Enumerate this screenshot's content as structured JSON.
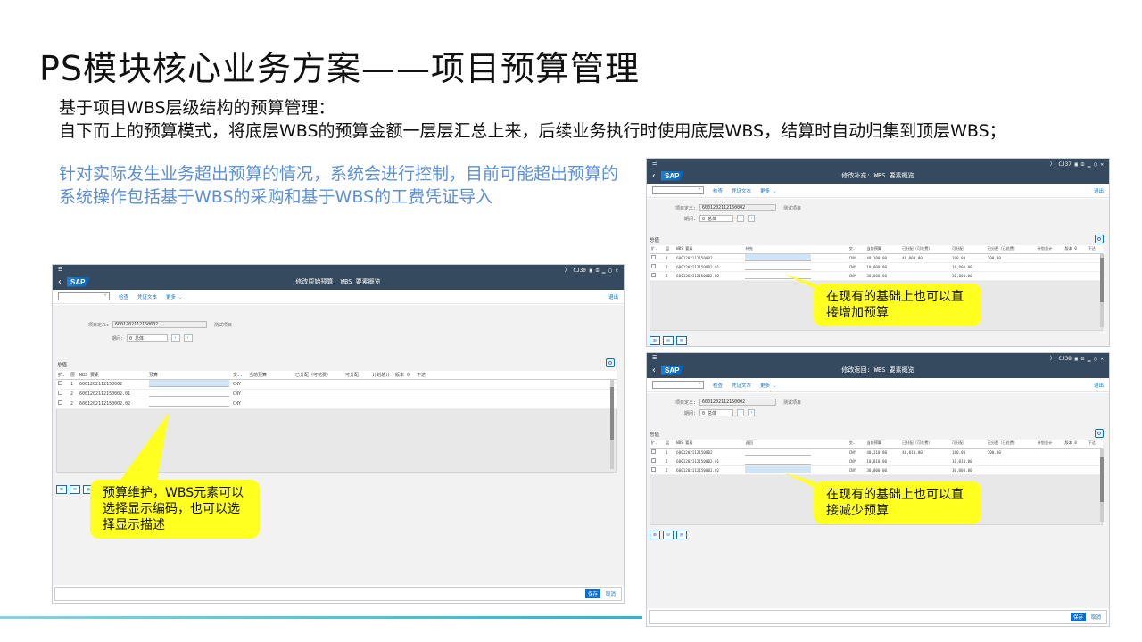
{
  "slide": {
    "title": "PS模块核心业务方案——项目预算管理",
    "intro_line1": "基于项目WBS层级结构的预算管理：",
    "intro_line2": "自下而上的预算模式，将底层WBS的预算金额一层层汇总上来，后续业务执行时使用底层WBS，结算时自动归集到顶层WBS；",
    "note": "针对实际发生业务超出预算的情况，系统会进行控制，目前可能超出预算的系统操作包括基于WBS的采购和基于WBS的工费凭证导入"
  },
  "callouts": {
    "left": "预算维护，WBS元素可以选择显示编码，也可以选择显示描述",
    "right_top": "在现有的基础上也可以直接增加预算",
    "right_bottom": "在现有的基础上也可以直接减少预算"
  },
  "window_main": {
    "tcode": "CJ30",
    "title": "修改原始预算: WBS 要素概览",
    "toolbar": [
      "检查",
      "凭证文本",
      "更多 ⌵"
    ],
    "exit": "退出",
    "project_label": "项目定义:",
    "project_value": "6001202112150002",
    "project_desc": "测试项目",
    "period_label": "期间:",
    "period_value": "0 总体",
    "section": "总值",
    "columns": [
      "扩.",
      "层",
      "WBS 要素",
      "预算",
      "交..",
      "当前预算",
      "已分配（可花费）",
      "可分配",
      "计划总计",
      "版本 0",
      "下达"
    ],
    "rows": [
      {
        "level": "1",
        "wbs": "6001202112150002",
        "cur": "CNY"
      },
      {
        "level": "2",
        "wbs": "6001202112150002.01",
        "cur": "CNY"
      },
      {
        "level": "2",
        "wbs": "6001202112150002.02",
        "cur": "CNY"
      }
    ],
    "save": "保存",
    "cancel": "取消"
  },
  "window_top": {
    "tcode": "CJ37",
    "title": "修改补充: WBS 要素概览",
    "toolbar": [
      "检查",
      "凭证文本",
      "更多 ⌵"
    ],
    "exit": "退出",
    "project_label": "项目定义:",
    "project_value": "6001202112150002",
    "project_desc": "测试项目",
    "period_label": "期间:",
    "period_value": "0 总体",
    "section": "总值",
    "columns": [
      "扩.",
      "层",
      "WBS 要素",
      "补充",
      "交..",
      "当前预算",
      "已分配（可花费）",
      "可分配",
      "已分配（已花费）",
      "计划总计",
      "版本 0",
      "下达"
    ],
    "rows": [
      {
        "level": "1",
        "wbs": "6001202112150002",
        "cur": "CNY",
        "budget": "40,100.00",
        "assigned": "40,000.00",
        "avail": "100.00",
        "spent": "100.00"
      },
      {
        "level": "2",
        "wbs": "6001202112150002.01",
        "cur": "CNY",
        "budget": "10,000.00",
        "assigned": "",
        "avail": "10,000.00",
        "spent": ""
      },
      {
        "level": "2",
        "wbs": "6001202112150002.02",
        "cur": "CNY",
        "budget": "30,000.00",
        "assigned": "",
        "avail": "30,000.00",
        "spent": ""
      }
    ]
  },
  "window_bottom": {
    "tcode": "CJ38",
    "title": "修改返回: WBS 要素概览",
    "toolbar": [
      "检查",
      "凭证文本",
      "更多 ⌵"
    ],
    "exit": "退出",
    "project_label": "项目定义:",
    "project_value": "6001202112150002",
    "project_desc": "测试项目",
    "period_label": "期间:",
    "period_value": "0 总体",
    "section": "总值",
    "columns": [
      "扩.",
      "层",
      "WBS 要素",
      "返回",
      "交..",
      "当前预算",
      "已分配（可花费）",
      "可分配",
      "已分配（已花费）",
      "计划总计",
      "版本 0",
      "下达"
    ],
    "rows": [
      {
        "level": "1",
        "wbs": "6001202112150002",
        "cur": "CNY",
        "budget": "40,110.00",
        "assigned": "40,010.00",
        "avail": "100.00",
        "spent": "100.00"
      },
      {
        "level": "2",
        "wbs": "6001202112150002.01",
        "cur": "CNY",
        "budget": "10,010.00",
        "assigned": "",
        "avail": "10,010.00",
        "spent": ""
      },
      {
        "level": "2",
        "wbs": "6001202112150002.02",
        "cur": "CNY",
        "budget": "30,000.00",
        "assigned": "",
        "avail": "30,000.00",
        "spent": ""
      }
    ],
    "save": "保存",
    "cancel": "取消"
  },
  "colors": {
    "shell": "#354a5f",
    "callout": "#ffff20",
    "note": "#5b8fd8",
    "sap_blue": "#0a6ed1"
  }
}
